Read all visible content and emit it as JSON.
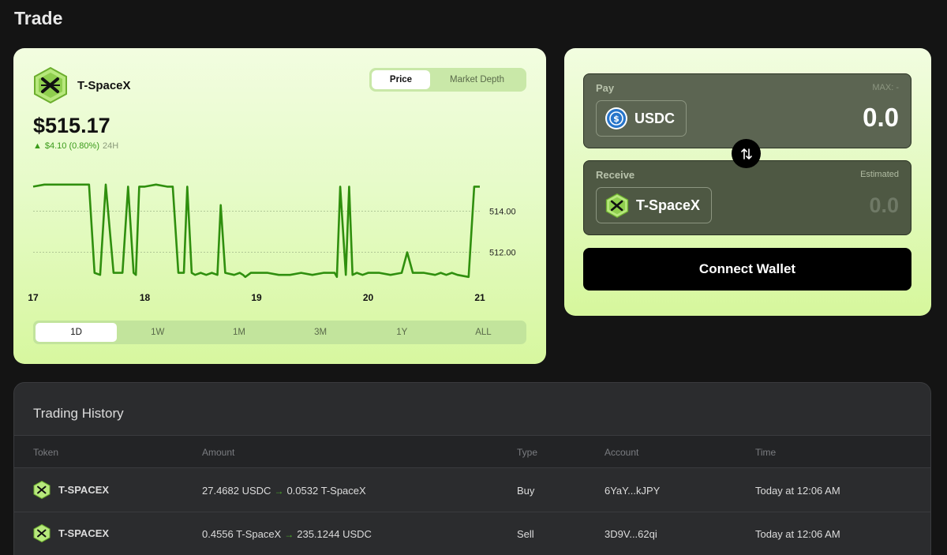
{
  "page": {
    "title": "Trade"
  },
  "token": {
    "name": "T-SpaceX",
    "price": "$515.17",
    "change_arrow": "▲",
    "change": "$4.10 (0.80%)",
    "change_period": "24H"
  },
  "chart_toggle": {
    "price": "Price",
    "market_depth": "Market Depth"
  },
  "ranges": [
    "1D",
    "1W",
    "1M",
    "3M",
    "1Y",
    "ALL"
  ],
  "chart_data": {
    "type": "line",
    "xlim": [
      17.0,
      21.0
    ],
    "ylim": [
      510.6,
      515.6
    ],
    "x_ticks": [
      17,
      18,
      19,
      20,
      21
    ],
    "y_ticks": [
      "514.00",
      "512.00"
    ],
    "y_tick_values": [
      514,
      512
    ],
    "color": "#2f8f0e",
    "x": [
      17.0,
      17.1,
      17.25,
      17.5,
      17.55,
      17.6,
      17.65,
      17.72,
      17.8,
      17.85,
      17.9,
      17.92,
      17.95,
      18.0,
      18.1,
      18.2,
      18.25,
      18.3,
      18.35,
      18.38,
      18.42,
      18.45,
      18.5,
      18.55,
      18.6,
      18.65,
      18.68,
      18.72,
      18.8,
      18.85,
      18.88,
      18.9,
      18.95,
      19.0,
      19.1,
      19.2,
      19.3,
      19.4,
      19.5,
      19.6,
      19.7,
      19.72,
      19.75,
      19.8,
      19.83,
      19.86,
      19.9,
      19.95,
      20.0,
      20.1,
      20.2,
      20.3,
      20.35,
      20.4,
      20.5,
      20.6,
      20.65,
      20.7,
      20.75,
      20.8,
      20.9,
      20.95,
      21.0
    ],
    "y": [
      515.2,
      515.3,
      515.3,
      515.3,
      511.0,
      510.9,
      515.3,
      511.0,
      511.0,
      515.2,
      511.0,
      510.9,
      515.2,
      515.2,
      515.3,
      515.2,
      515.2,
      511.0,
      511.0,
      515.2,
      511.0,
      510.9,
      511.0,
      510.9,
      511.0,
      510.9,
      514.3,
      511.0,
      510.9,
      511.0,
      510.9,
      510.8,
      511.0,
      511.0,
      511.0,
      510.9,
      510.9,
      511.0,
      510.9,
      511.0,
      511.0,
      510.8,
      515.2,
      510.9,
      515.2,
      510.9,
      511.0,
      510.9,
      511.0,
      511.0,
      510.9,
      511.0,
      512.0,
      511.0,
      511.0,
      510.9,
      511.0,
      510.9,
      511.0,
      510.9,
      510.8,
      515.2,
      515.2
    ]
  },
  "swap": {
    "pay_label": "Pay",
    "max_label": "MAX: -",
    "pay_asset": "USDC",
    "pay_amount": "0.0",
    "receive_label": "Receive",
    "estimated_label": "Estimated",
    "receive_asset": "T-SpaceX",
    "receive_amount": "0.0",
    "connect_label": "Connect Wallet"
  },
  "history": {
    "title": "Trading History",
    "columns": [
      "Token",
      "Amount",
      "Type",
      "Account",
      "Time"
    ],
    "rows": [
      {
        "token": "T-SPACEX",
        "amount_from": "27.4682 USDC",
        "arrow": "→",
        "amount_to": "0.0532 T-SpaceX",
        "type": "Buy",
        "account": "6YaY...kJPY",
        "time": "Today at 12:06 AM"
      },
      {
        "token": "T-SPACEX",
        "amount_from": "0.4556 T-SpaceX",
        "arrow": "→",
        "amount_to": "235.1244 USDC",
        "type": "Sell",
        "account": "3D9V...62qi",
        "time": "Today at 12:06 AM"
      }
    ]
  },
  "colors": {
    "accent_green": "#2f8f0e",
    "card_bg": "#e6fbc8",
    "page_bg": "#141414"
  }
}
